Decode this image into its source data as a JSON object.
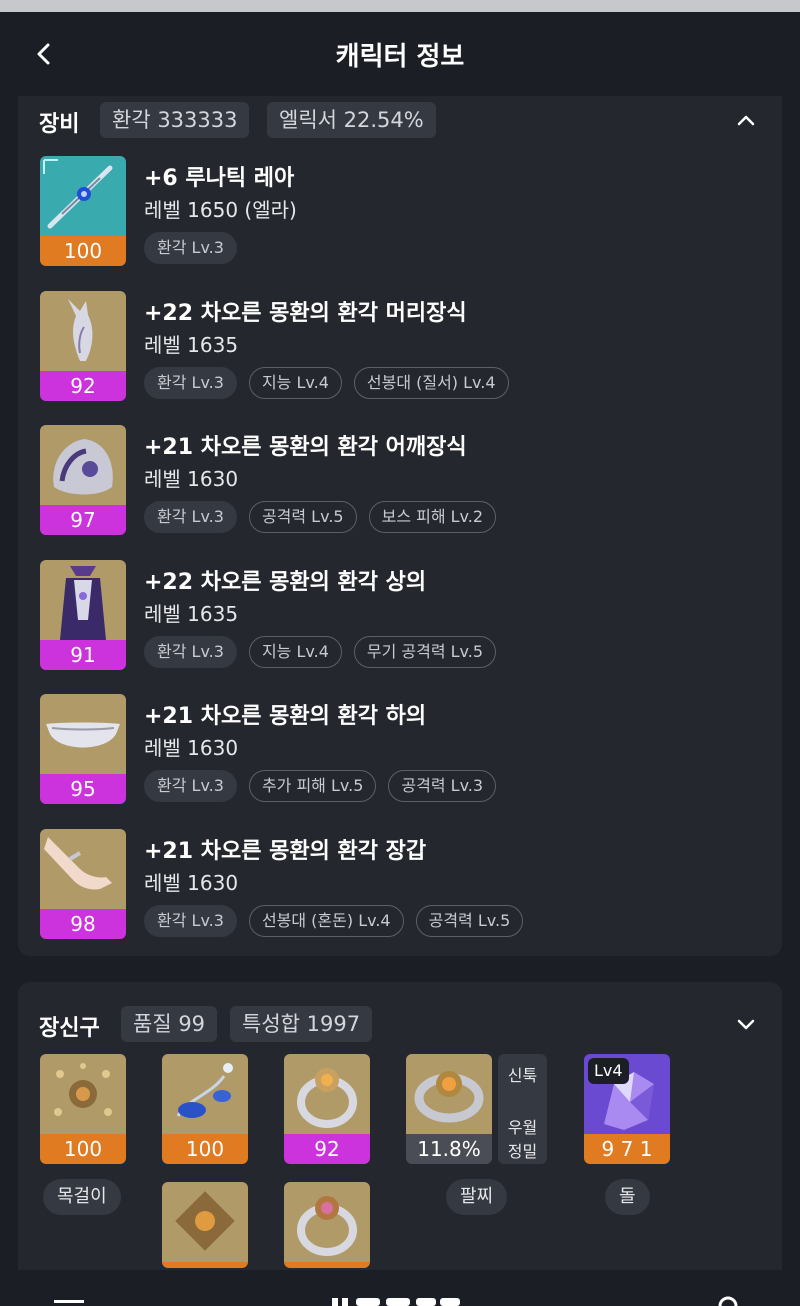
{
  "header": {
    "title": "캐릭터 정보"
  },
  "equipment": {
    "title": "장비",
    "pills": [
      "환각 333333",
      "엘릭서 22.54%"
    ],
    "items": [
      {
        "quality": "100",
        "quality_color": "#e07b22",
        "name": "+6 루나틱 레아",
        "level": "레벨 1650 (엘라)",
        "tags": [
          {
            "text": "환각 Lv.3",
            "style": "solid"
          }
        ],
        "icon": "staff-icon"
      },
      {
        "quality": "92",
        "quality_color": "#cc33dd",
        "name": "+22 차오른 몽환의 환각 머리장식",
        "level": "레벨 1635",
        "tags": [
          {
            "text": "환각 Lv.3",
            "style": "solid"
          },
          {
            "text": "지능 Lv.4",
            "style": "outline"
          },
          {
            "text": "선봉대 (질서) Lv.4",
            "style": "outline"
          }
        ],
        "icon": "headpiece-icon"
      },
      {
        "quality": "97",
        "quality_color": "#cc33dd",
        "name": "+21 차오른 몽환의 환각 어깨장식",
        "level": "레벨 1630",
        "tags": [
          {
            "text": "환각 Lv.3",
            "style": "solid"
          },
          {
            "text": "공격력 Lv.5",
            "style": "outline"
          },
          {
            "text": "보스 피해 Lv.2",
            "style": "outline"
          }
        ],
        "icon": "shoulder-icon"
      },
      {
        "quality": "91",
        "quality_color": "#cc33dd",
        "name": "+22 차오른 몽환의 환각 상의",
        "level": "레벨 1635",
        "tags": [
          {
            "text": "환각 Lv.3",
            "style": "solid"
          },
          {
            "text": "지능 Lv.4",
            "style": "outline"
          },
          {
            "text": "무기 공격력 Lv.5",
            "style": "outline"
          }
        ],
        "icon": "chest-icon"
      },
      {
        "quality": "95",
        "quality_color": "#cc33dd",
        "name": "+21 차오른 몽환의 환각 하의",
        "level": "레벨 1630",
        "tags": [
          {
            "text": "환각 Lv.3",
            "style": "solid"
          },
          {
            "text": "추가 피해 Lv.5",
            "style": "outline"
          },
          {
            "text": "공격력 Lv.3",
            "style": "outline"
          }
        ],
        "icon": "pants-icon"
      },
      {
        "quality": "98",
        "quality_color": "#cc33dd",
        "name": "+21 차오른 몽환의 환각 장갑",
        "level": "레벨 1630",
        "tags": [
          {
            "text": "환각 Lv.3",
            "style": "solid"
          },
          {
            "text": "선봉대 (혼돈) Lv.4",
            "style": "outline"
          },
          {
            "text": "공격력 Lv.5",
            "style": "outline"
          }
        ],
        "icon": "glove-icon"
      }
    ]
  },
  "accessories": {
    "title": "장신구",
    "pills": [
      "품질 99",
      "특성합 1997"
    ],
    "items": [
      {
        "value": "100",
        "color": "#e07b22",
        "icon": "necklace-icon"
      },
      {
        "value": "100",
        "color": "#e07b22",
        "icon": "earring-icon"
      },
      {
        "value": "92",
        "color": "#cc33dd",
        "icon": "ring-icon"
      },
      {
        "value": "11.8%",
        "color": "#4a4d55",
        "icon": "bracelet-icon"
      },
      {
        "value": "9 7 1",
        "color": "#e07b22",
        "icon": "stone-icon",
        "badge": "Lv4"
      }
    ],
    "bracelet_side": [
      "신툭",
      "우월",
      "정밀"
    ],
    "labels": [
      "목걸이",
      "팔찌",
      "돌"
    ]
  }
}
